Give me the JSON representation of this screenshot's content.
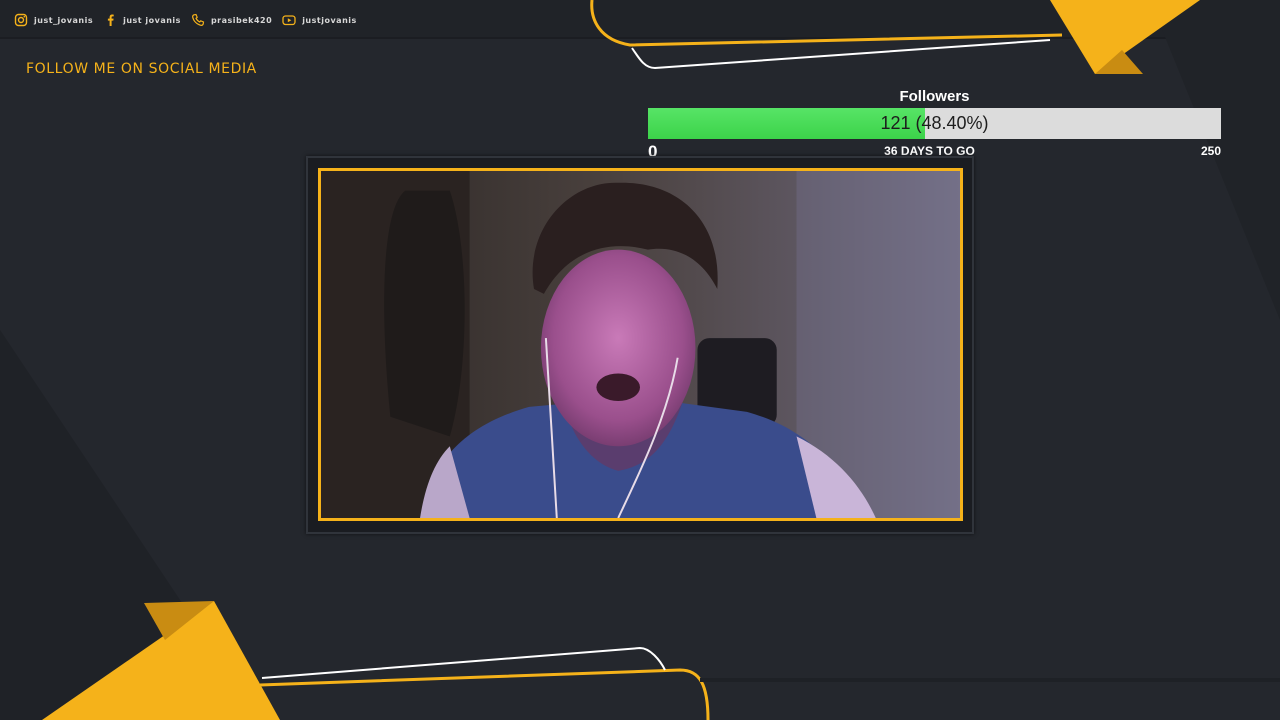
{
  "colors": {
    "accent": "#f5b21a",
    "background": "#24272d",
    "progress_fill": "#44d651",
    "progress_track": "#dcdcdc"
  },
  "social": [
    {
      "icon": "instagram-icon",
      "label": "just_jovanis"
    },
    {
      "icon": "facebook-icon",
      "label": "just jovanis"
    },
    {
      "icon": "phone-icon",
      "label": "prasibek420"
    },
    {
      "icon": "youtube-icon",
      "label": "justjovanis"
    }
  ],
  "follow_text": "FOLLOW ME ON SOCIAL MEDIA",
  "goal": {
    "title": "Followers",
    "current_display": "121 (48.40%)",
    "current": 121,
    "target": 250,
    "min_label": "0",
    "max_label": "250",
    "days_left": "36 DAYS TO GO"
  }
}
